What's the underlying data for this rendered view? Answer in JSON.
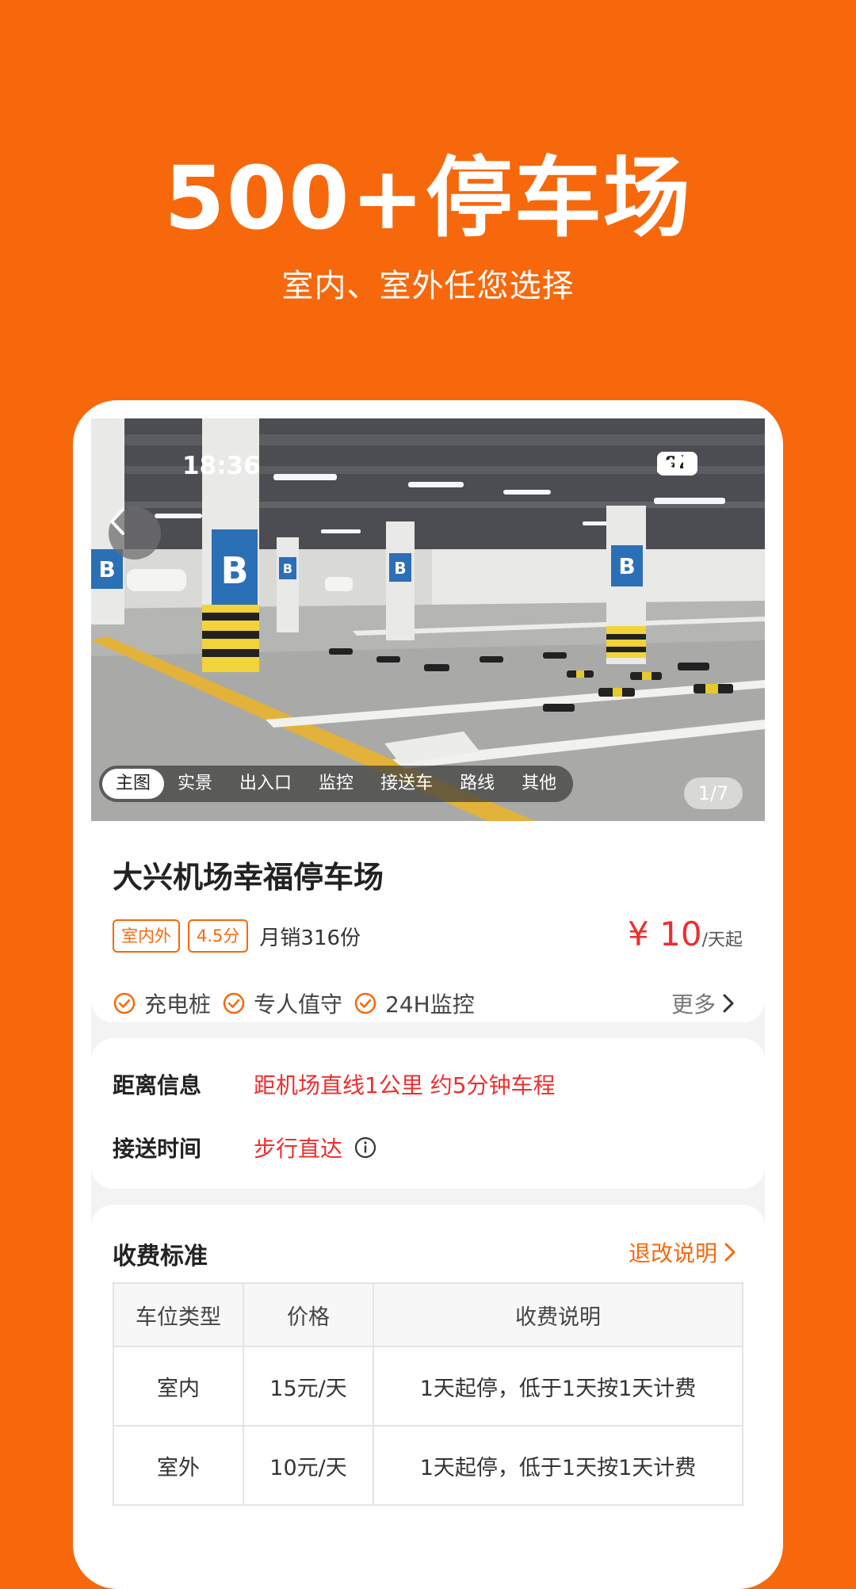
{
  "hero": {
    "title": "500+停车场",
    "subtitle": "室内、室外任您选择"
  },
  "status_bar": {
    "time": "18:36",
    "battery": "92"
  },
  "photo": {
    "tabs": [
      "主图",
      "实景",
      "出入口",
      "监控",
      "接送车",
      "路线",
      "其他"
    ],
    "active_tab": "主图",
    "counter": "1/7"
  },
  "lot": {
    "name": "大兴机场幸福停车场",
    "tags": [
      "室内外",
      "4.5分"
    ],
    "sales": "月销316份",
    "price_symbol": "¥",
    "price_value": "10",
    "price_unit": "/天起",
    "features": [
      "充电桩",
      "专人值守",
      "24H监控"
    ],
    "more_label": "更多"
  },
  "distance": {
    "label": "距离信息",
    "value": "距机场直线1公里 约5分钟车程"
  },
  "shuttle": {
    "label": "接送时间",
    "value": "步行直达"
  },
  "fees": {
    "title": "收费标准",
    "refund_label": "退改说明",
    "headers": [
      "车位类型",
      "价格",
      "收费说明"
    ],
    "rows": [
      [
        "室内",
        "15元/天",
        "1天起停，低于1天按1天计费"
      ],
      [
        "室外",
        "10元/天",
        "1天起停，低于1天按1天计费"
      ]
    ]
  },
  "colors": {
    "brand": "#F7680C",
    "price_red": "#F02D2D"
  }
}
